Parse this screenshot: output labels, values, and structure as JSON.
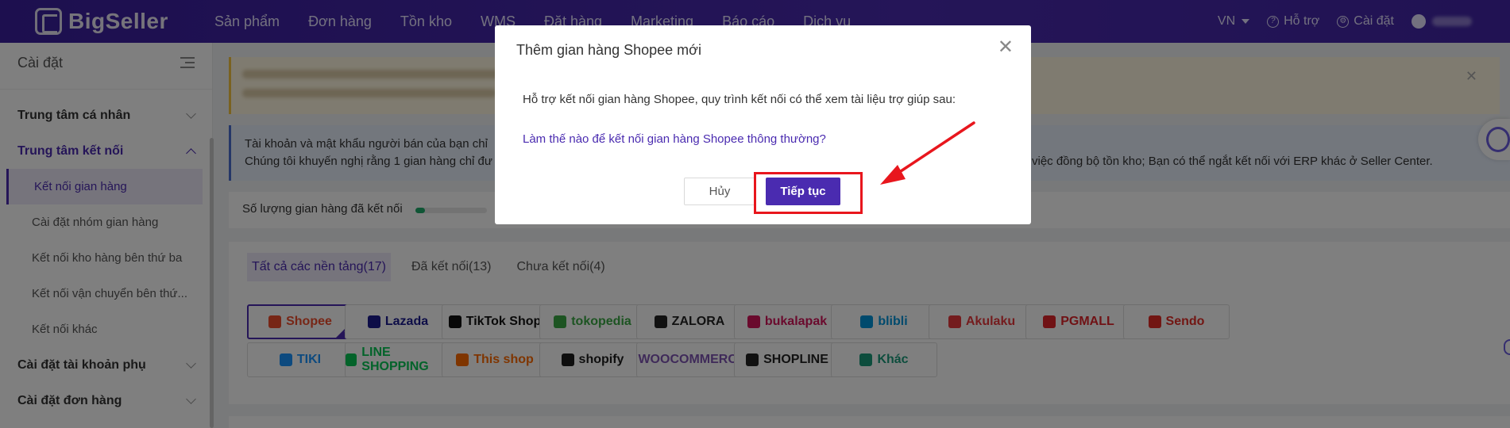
{
  "brand": {
    "name": "BigSeller"
  },
  "nav": [
    "Sản phẩm",
    "Đơn hàng",
    "Tồn kho",
    "WMS",
    "Đặt hàng",
    "Marketing",
    "Báo cáo",
    "Dịch vụ"
  ],
  "header_right": {
    "lang": "VN",
    "help": "Hỗ trợ",
    "settings": "Cài đặt"
  },
  "sidebar": {
    "title": "Cài đặt",
    "groups": [
      {
        "label": "Trung tâm cá nhân"
      },
      {
        "label": "Trung tâm kết nối"
      }
    ],
    "sub_items": [
      "Kết nối gian hàng",
      "Cài đặt nhóm gian hàng",
      "Kết nối kho hàng bên thứ ba",
      "Kết nối vận chuyển bên thứ...",
      "Kết nối khác"
    ],
    "groups_after": [
      {
        "label": "Cài đặt tài khoản phụ"
      },
      {
        "label": "Cài đặt đơn hàng"
      }
    ]
  },
  "info_banner": {
    "line1": "Tài khoản và mật khẩu người bán của bạn chỉ",
    "line2": "Chúng tôi khuyến nghị rằng 1 gian hàng chỉ đư",
    "line2_end": "việc đồng bộ tồn kho; Bạn có thể ngắt kết nối với ERP khác ở Seller Center."
  },
  "connected_label": "Số lượng gian hàng đã kết nối",
  "connected_fraction": 0.13,
  "tabs": [
    "Tất cả các nền tảng(17)",
    "Đã kết nối(13)",
    "Chưa kết nối(4)"
  ],
  "platforms": [
    {
      "name": "Shopee",
      "color": "#ee4d2d"
    },
    {
      "name": "Lazada",
      "color": "#1a1a8f"
    },
    {
      "name": "TikTok Shop",
      "color": "#111111"
    },
    {
      "name": "tokopedia",
      "color": "#3aa845"
    },
    {
      "name": "ZALORA",
      "color": "#222222"
    },
    {
      "name": "bukalapak",
      "color": "#d4145a"
    },
    {
      "name": "blibli",
      "color": "#0095da"
    },
    {
      "name": "Akulaku",
      "color": "#e8383d"
    },
    {
      "name": "PGMALL",
      "color": "#e0242b"
    },
    {
      "name": "Sendo",
      "color": "#e52d27"
    },
    {
      "name": "TIKI",
      "color": "#1a94ff"
    },
    {
      "name": "LINE SHOPPING",
      "color": "#06c755"
    },
    {
      "name": "This shop",
      "color": "#ff6a00"
    },
    {
      "name": "shopify",
      "color": "#1d1d1d"
    },
    {
      "name": "WOOCOMMERCE",
      "color": "#7f54b3"
    },
    {
      "name": "SHOPLINE",
      "color": "#222222"
    },
    {
      "name": "Khác",
      "color": "#1a9a7a"
    }
  ],
  "modal": {
    "title": "Thêm gian hàng Shopee mới",
    "description": "Hỗ trợ kết nối gian hàng Shopee, quy trình kết nối có thể xem tài liệu trợ giúp sau:",
    "link": "Làm thế nào để kết nối gian hàng Shopee thông thường?",
    "cancel": "Hủy",
    "confirm": "Tiếp tục"
  },
  "colors": {
    "accent": "#4a2bb0",
    "annotation": "#e8161d"
  }
}
